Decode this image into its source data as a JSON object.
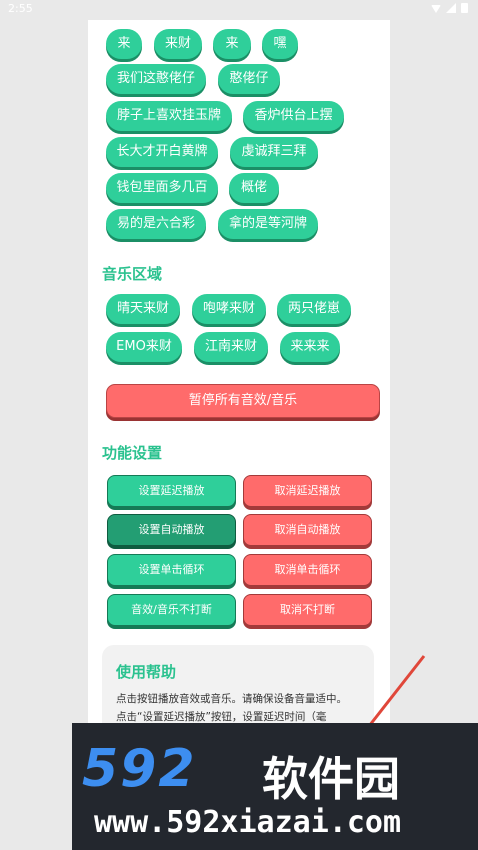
{
  "status": {
    "time": "2:55"
  },
  "sounds": {
    "rows": [
      [
        "来",
        "来财",
        "来",
        "嘿"
      ],
      [
        "我们这憨佬仔",
        "憨佬仔"
      ],
      [
        "脖子上喜欢挂玉牌",
        "香炉供台上摆"
      ],
      [
        "长大才开白黄牌",
        "虔诚拜三拜"
      ],
      [
        "钱包里面多几百",
        "概佬"
      ],
      [
        "易的是六合彩",
        "拿的是等河牌"
      ]
    ]
  },
  "music": {
    "title": "音乐区域",
    "rows": [
      [
        "晴天来财",
        "咆哮来财",
        "两只佬崽"
      ],
      [
        "EMO来财",
        "江南来财",
        "来来来"
      ]
    ]
  },
  "pause_all": "暂停所有音效/音乐",
  "settings": {
    "title": "功能设置",
    "buttons": [
      {
        "on": "设置延迟播放",
        "off": "取消延迟播放"
      },
      {
        "on": "设置自动播放",
        "off": "取消自动播放"
      },
      {
        "on": "设置单击循环",
        "off": "取消单击循环"
      },
      {
        "on": "音效/音乐不打断",
        "off": "取消不打断"
      }
    ]
  },
  "help": {
    "title": "使用帮助",
    "lines": [
      "点击按钮播放音效或音乐。请确保设备音量适中。",
      "点击“设置延迟播放”按钮，设置延迟时间（毫"
    ]
  },
  "watermark": {
    "brand_num": "592",
    "brand_cn": "软件园",
    "url": "www.592xiazai.com"
  }
}
